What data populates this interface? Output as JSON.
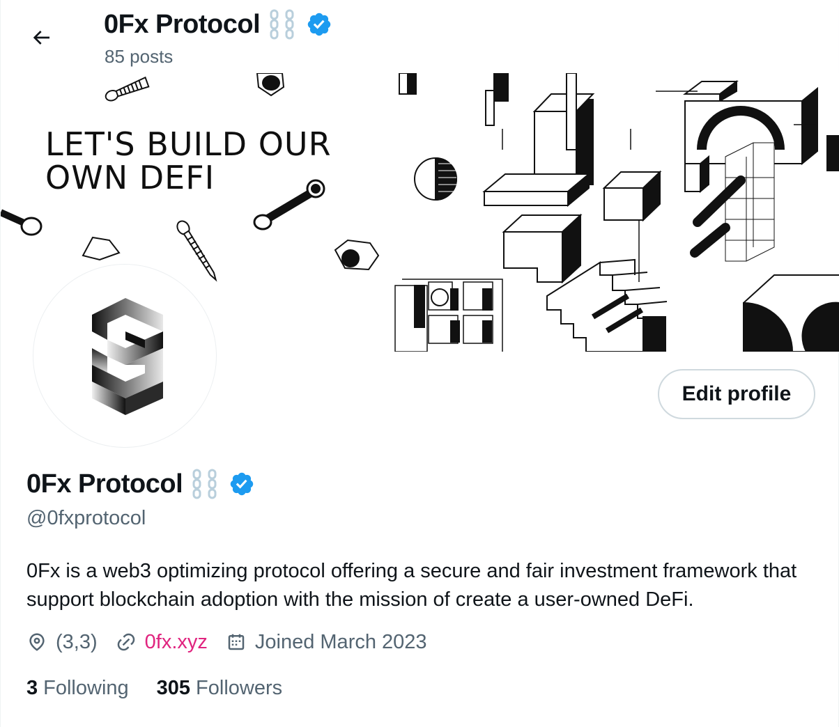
{
  "header": {
    "back_icon": "arrow-left-icon",
    "name": "0Fx Protocol",
    "posts_count": "85 posts"
  },
  "banner": {
    "headline_line1": "LET'S BUILD OUR",
    "headline_line2": "OWN DEFI"
  },
  "profile": {
    "name": "0Fx Protocol",
    "handle": "@0fxprotocol",
    "bio": "0Fx is a web3 optimizing protocol offering a secure and fair investment framework that support blockchain adoption with the mission of create a user-owned DeFi.",
    "location": "(3,3)",
    "website": "0fx.xyz",
    "joined": "Joined March 2023",
    "following_count": "3",
    "following_label": "Following",
    "followers_count": "305",
    "followers_label": "Followers"
  },
  "buttons": {
    "edit_profile": "Edit profile"
  },
  "colors": {
    "verified": "#1d9bf0",
    "link": "#e0247f",
    "secondary_text": "#536471",
    "chain_emoji": "#b9cfdc"
  },
  "icons": {
    "name_badge": "chain-link-icon",
    "verified": "verified-badge-icon",
    "location": "location-pin-icon",
    "website": "link-icon",
    "joined": "calendar-icon"
  }
}
